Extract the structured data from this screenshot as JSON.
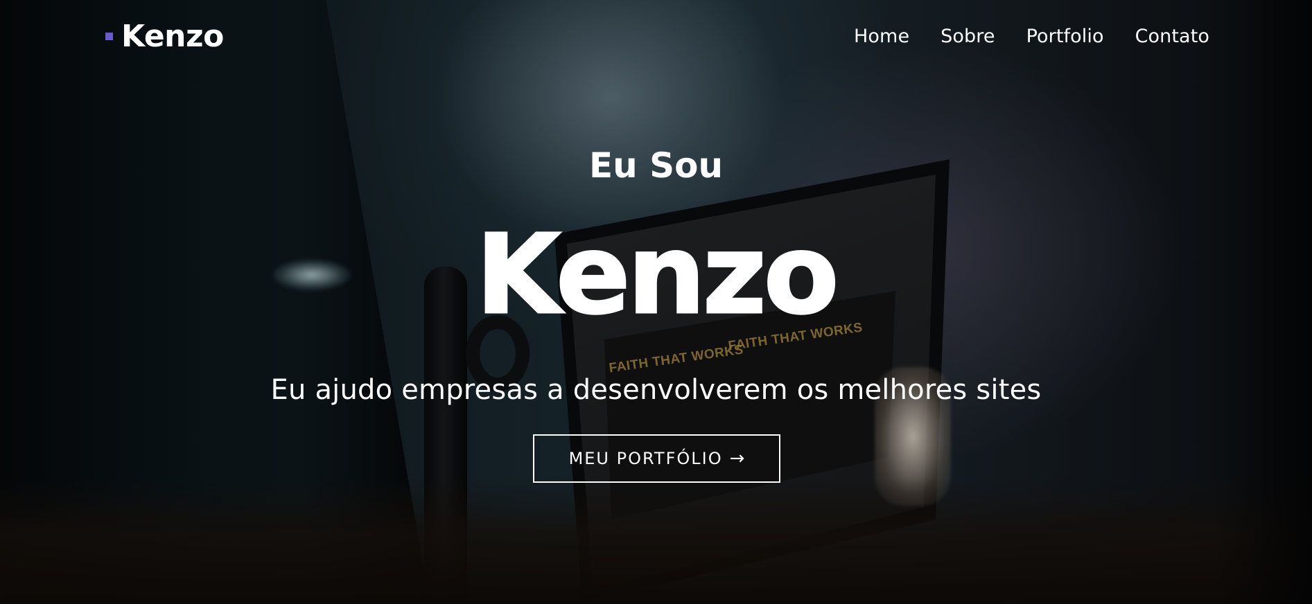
{
  "navbar": {
    "brand": "Kenzo",
    "links": [
      "Home",
      "Sobre",
      "Portfolio",
      "Contato"
    ]
  },
  "hero": {
    "intro": "Eu Sou",
    "name": "Kenzo",
    "tagline": "Eu ajudo empresas a desenvolverem os melhores sites",
    "cta_label": "MEU PORTFÓLIO",
    "cta_icon": "arrow-right-icon",
    "cta_arrow": "→"
  },
  "background": {
    "screen_text_1": "FAITH THAT WORKS",
    "screen_text_2": "FAITH THAT WORKS"
  },
  "colors": {
    "brand_accent": "#6a5acd",
    "text": "#ffffff"
  }
}
